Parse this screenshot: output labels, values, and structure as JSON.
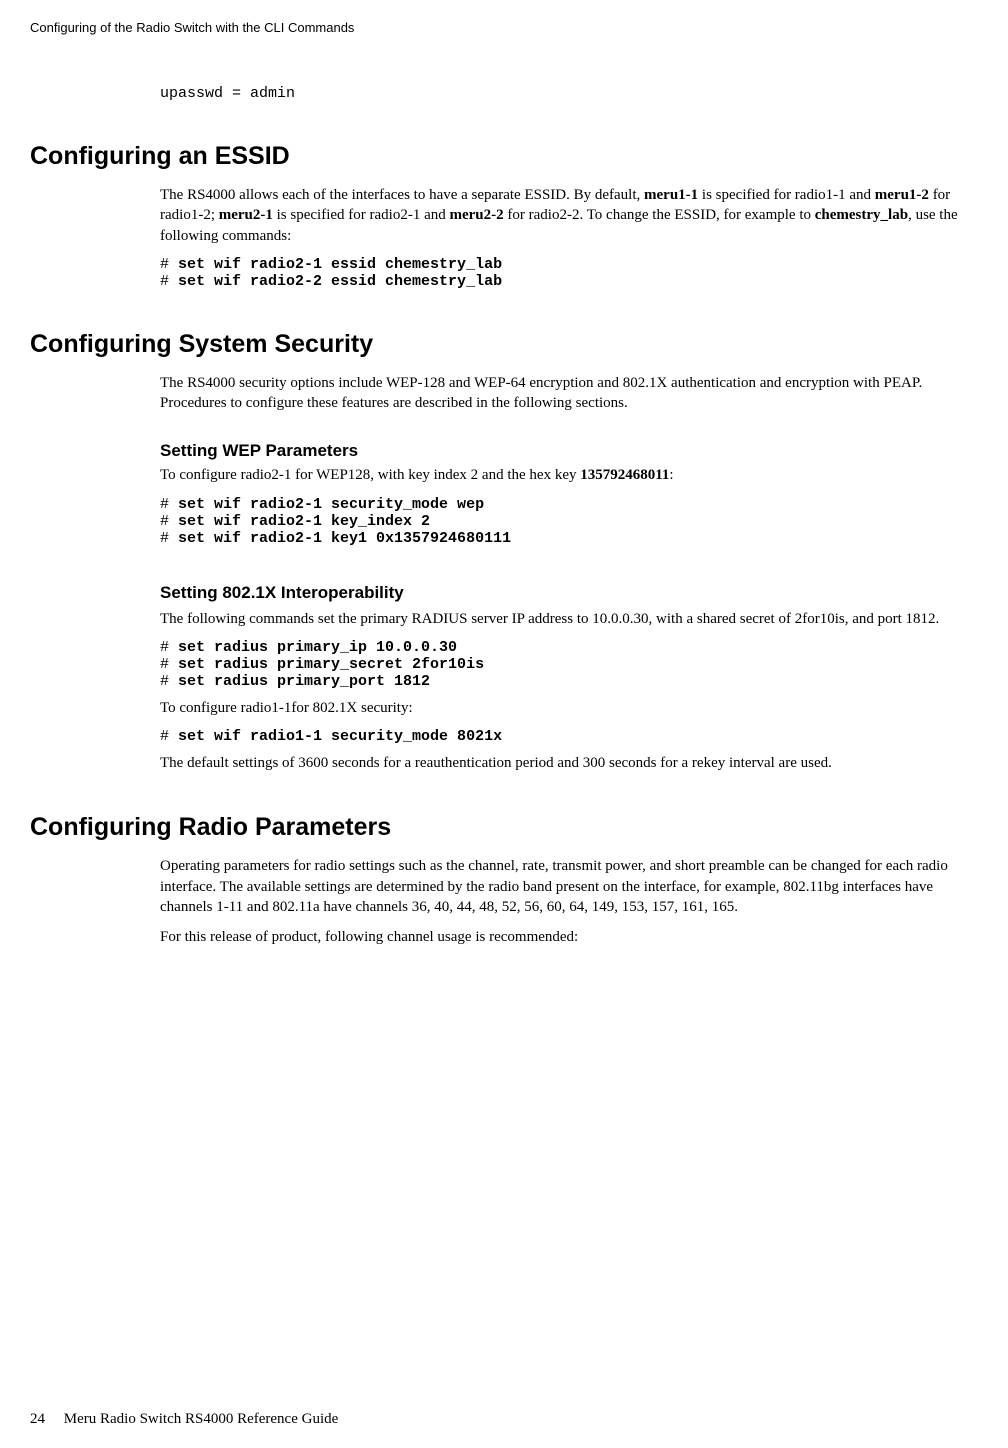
{
  "runningHeader": "Configuring of the Radio Switch with the CLI Commands",
  "topCode": "upasswd = admin",
  "sec1": {
    "title": "Configuring an ESSID",
    "para1_pre": "The RS4000 allows each of the interfaces to have a separate ESSID. By default, ",
    "para1_b1": "meru1-1",
    "para1_mid1": " is specified for radio1-1 and ",
    "para1_b2": "meru1-2",
    "para1_mid2": " for radio1-2; ",
    "para1_b3": "meru2-1",
    "para1_mid3": " is specified for radio2-1 and ",
    "para1_b4": "meru2-2",
    "para1_mid4": " for radio2-2. To change the ESSID, for example to ",
    "para1_b5": "chemestry_lab",
    "para1_end": ", use the following commands:",
    "code1_prompt": "# ",
    "code1_cmd": "set wif radio2-1 essid chemestry_lab",
    "code2_prompt": "# ",
    "code2_cmd": "set wif radio2-2 essid chemestry_lab"
  },
  "sec2": {
    "title": "Configuring System Security",
    "para1": "The RS4000 security options include WEP-128 and WEP-64 encryption and 802.1X authentication and encryption with PEAP. Procedures to configure these features are described in the following sections.",
    "sub1_title": "Setting WEP Parameters",
    "sub1_para_pre": "To configure radio2-1 for WEP128, with key index 2 and the hex key ",
    "sub1_para_b": "135792468011",
    "sub1_para_end": ":",
    "sub1_code1_p": "# ",
    "sub1_code1_c": "set wif radio2-1 security_mode wep",
    "sub1_code2_p": "# ",
    "sub1_code2_c": "set wif radio2-1 key_index 2",
    "sub1_code3_p": "# ",
    "sub1_code3_c": "set wif radio2-1 key1 0x1357924680111",
    "sub2_title": "Setting 802.1X Interoperability",
    "sub2_para1": "The following commands set the primary RADIUS server IP address to 10.0.0.30, with a shared secret of 2for10is, and port 1812.",
    "sub2_code1_p": "# ",
    "sub2_code1_c": "set radius primary_ip 10.0.0.30",
    "sub2_code2_p": "# ",
    "sub2_code2_c": "set radius primary_secret 2for10is",
    "sub2_code3_p": "# ",
    "sub2_code3_c": "set radius primary_port 1812",
    "sub2_para2": "To configure radio1-1for 802.1X security:",
    "sub2_code4_p": "# ",
    "sub2_code4_c": "set wif radio1-1 security_mode 8021x",
    "sub2_para3": "The default settings of 3600 seconds for a reauthentication period and 300 seconds for a rekey interval are used."
  },
  "sec3": {
    "title": "Configuring Radio Parameters",
    "para1": "Operating parameters for radio settings such as the channel, rate, transmit power, and short preamble can be changed for each radio interface. The available settings are determined by the radio band present on the interface, for example, 802.11bg interfaces have channels 1-11 and 802.11a have channels 36, 40, 44, 48, 52, 56, 60, 64, 149, 153, 157, 161, 165.",
    "para2": "For this release of product, following channel usage is recommended:"
  },
  "footer": {
    "pageNumber": "24",
    "title": "Meru Radio Switch RS4000 Reference Guide"
  }
}
